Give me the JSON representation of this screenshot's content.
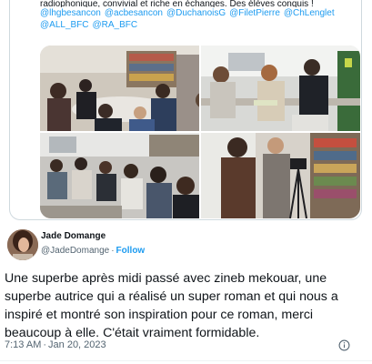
{
  "quoted_tweet": {
    "text_line": "radiophonique, convivial et riche en échanges. Des élèves conquis !",
    "mentions": [
      "@lhgbesancon",
      "@acbesancon",
      "@DuchanoisG",
      "@FiletPierre",
      "@ChLenglet",
      "@ALL_BFC",
      "@RA_BFC"
    ]
  },
  "tweet": {
    "author_name": "Jade Domange",
    "author_handle": "@JadeDomange",
    "separator": "·",
    "follow_label": "Follow",
    "text": "Une superbe après midi passé avec zineb mekouar, une superbe autrice qui a réalisé un super roman et qui nous a inspiré et montré son inspiration pour ce roman, merci beaucoup à elle. C'était vraiment formidable.",
    "time": "7:13 AM",
    "date": "Jan 20, 2023",
    "meta_separator": "·"
  },
  "icons": {
    "info": "info-icon",
    "avatar": "avatar"
  },
  "colors": {
    "link": "#1d9bf0",
    "text": "#0f1419",
    "muted": "#536471",
    "border": "#cfd9de"
  }
}
